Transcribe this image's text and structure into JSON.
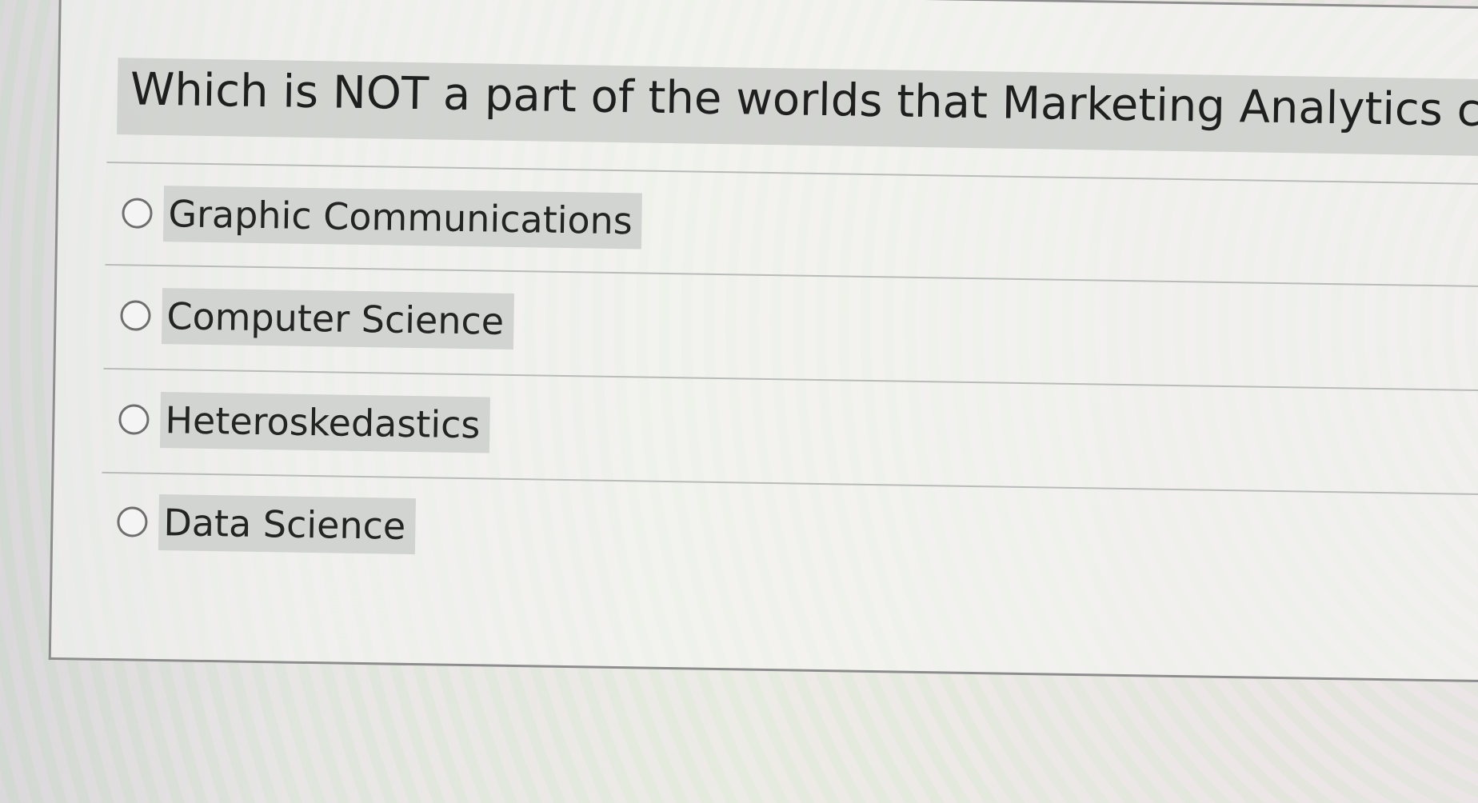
{
  "question": {
    "text": "Which is NOT a part of the worlds that Marketing Analytics combines?"
  },
  "answers": [
    {
      "label": "Graphic Communications"
    },
    {
      "label": "Computer Science"
    },
    {
      "label": "Heteroskedastics"
    },
    {
      "label": "Data Science"
    }
  ]
}
